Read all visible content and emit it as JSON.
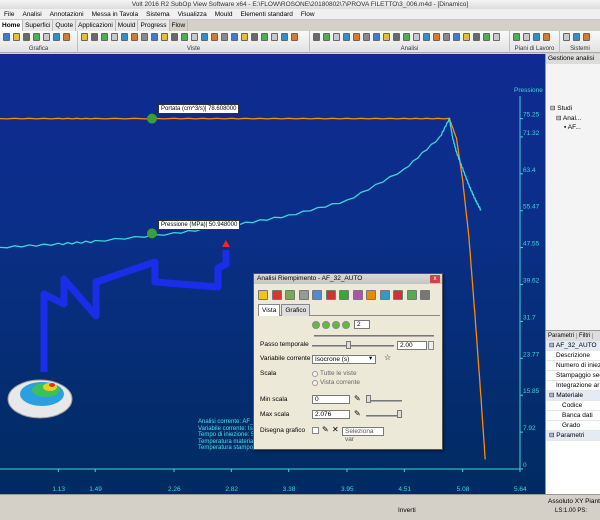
{
  "window_title": "Volt 2016 R2 SubOp View Software x64 - E:\\FLOW\\ROSONE\\20180802\\7\\PROVA FILETTO\\3_006.m4d - [Dinamico]",
  "menu": [
    "File",
    "Analisi",
    "Annotazioni",
    "Messa in Tavola",
    "Sistema",
    "Visualizza",
    "Mould",
    "Elementi standard",
    "Flow"
  ],
  "tabs": [
    "Home",
    "Superfici",
    "Quote",
    "Applicazioni",
    "Mould",
    "Progress",
    "Flow"
  ],
  "ribbon_groups": [
    "Grafica",
    "Viste",
    "Analisi",
    "Piani di Lavoro",
    "Sistemi"
  ],
  "chart_data": {
    "type": "line",
    "ylabel": "Pressione [MPa]",
    "x_ticks": [
      "1.13",
      "1.49",
      "2.26",
      "2.82",
      "3.38",
      "3.95",
      "4.51",
      "5.08",
      "5.64"
    ],
    "y_ticks": [
      "75.25",
      "71.32",
      "63.4",
      "55.47",
      "47.55",
      "39.62",
      "31.7",
      "23.77",
      "15.85",
      "7.92",
      "0"
    ],
    "ylim": [
      0,
      79.25
    ],
    "xlim": [
      0.56,
      5.64
    ],
    "series": [
      {
        "color": "#3fd6d6",
        "x": [
          0.56,
          1.13,
          1.49,
          2.26,
          2.82,
          3.38,
          3.95,
          4.51,
          4.86,
          4.95,
          4.98,
          5.02,
          5.08,
          5.14,
          5.2,
          5.26
        ],
        "y": [
          47.6,
          48.3,
          48.9,
          50.6,
          52.3,
          54.4,
          57.6,
          64.3,
          71.3,
          75.25,
          71.3,
          68.0,
          64.5,
          61.0,
          58.0,
          55.5
        ]
      },
      {
        "color": "#ff8a00",
        "x": [
          0.56,
          1.13,
          1.49,
          2.26,
          2.82,
          3.38,
          3.95,
          4.51,
          4.95,
          5.02,
          5.08,
          5.14,
          5.2,
          5.26,
          5.3
        ],
        "y": [
          75.25,
          75.25,
          75.25,
          75.25,
          75.25,
          75.25,
          75.25,
          75.25,
          75.25,
          71.0,
          62.0,
          50.0,
          33.0,
          15.0,
          2.0
        ]
      }
    ],
    "annotations": [
      {
        "label": "Portata (cm^3/s)",
        "value": "78.608000"
      },
      {
        "label": "Pressione (MPa)",
        "value": "50.948000"
      }
    ]
  },
  "info_lines": [
    "Analisi corrente:  AF_...",
    "Variabile corrente:  Iso...",
    "Tempo di iniezione:  5...",
    "Temperatura materiale...",
    "Temperatura stampo:..."
  ],
  "dialog": {
    "title": "Analisi Riempimento - AF_32_AUTO",
    "close": "x",
    "tabs": [
      "Vista",
      "Grafico"
    ],
    "frame": "2",
    "passo_label": "Passo temporale",
    "passo_value": "2.00",
    "var_label": "Variabile corrente",
    "var_value": "Isocrone (s)",
    "scala_label": "Scala",
    "scala_opts": [
      "Tutte le viste",
      "Vista corrente"
    ],
    "min_label": "Min scala",
    "min_value": "0",
    "max_label": "Max scala",
    "max_value": "2.076",
    "disegna_label": "Disegna grafico",
    "sel_var": "Seleziona var"
  },
  "right_panel": {
    "title": "Gestione analisi",
    "tree": [
      "Studi",
      "Anal...",
      "AF..."
    ],
    "props_tabs": [
      "Parametri",
      "Filtri"
    ],
    "header": "AF_32_AUTO",
    "rows": [
      {
        "label": "Descrizione",
        "kind": "row"
      },
      {
        "label": "Numero di iniezi",
        "kind": "row"
      },
      {
        "label": "Stampaggio sec",
        "kind": "row"
      },
      {
        "label": "Integrazione ar",
        "kind": "row"
      },
      {
        "label": "Materiale",
        "kind": "grp"
      },
      {
        "label": "Codice",
        "kind": "sub"
      },
      {
        "label": "Banca dati",
        "kind": "sub"
      },
      {
        "label": "Grado",
        "kind": "sub"
      },
      {
        "label": "Parametri",
        "kind": "grp"
      }
    ]
  },
  "bottom": {
    "invert": "Inverti",
    "xy": "Assoluto XY Piant",
    "status": "LS:1.00 PS:"
  }
}
